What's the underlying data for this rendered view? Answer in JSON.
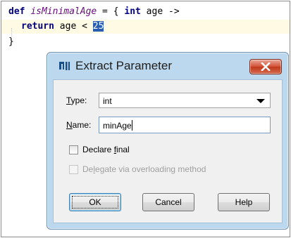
{
  "editor": {
    "line1": {
      "kw": "def",
      "ident": "isMinimalAge",
      "rest": " = { ",
      "type_kw": "int",
      "tail": " age ->"
    },
    "line2": {
      "kw": "return",
      "expr": " age < ",
      "selected": "25"
    },
    "line3": {
      "text": "}"
    }
  },
  "dialog": {
    "title": "Extract Parameter",
    "type": {
      "label_mnemonic": "T",
      "label_rest": "ype:",
      "value": "int"
    },
    "name": {
      "label_mnemonic": "N",
      "label_rest": "ame:",
      "value": "minAge"
    },
    "declare_final": {
      "label_pre": "Declare ",
      "label_mnemonic": "f",
      "label_post": "inal",
      "checked": false
    },
    "delegate": {
      "label_pre": "De",
      "label_mnemonic": "l",
      "label_post": "egate via overloading method",
      "checked": false,
      "enabled": false
    },
    "buttons": {
      "ok": "OK",
      "cancel": "Cancel",
      "help": "Help"
    }
  },
  "icons": {
    "app": "intellij-idea-icon",
    "close": "close-icon",
    "dropdown": "chevron-down-icon"
  },
  "colors": {
    "keyword": "#000080",
    "identifier": "#660e7a",
    "selection": "#2a5db0",
    "current_line": "#fffae3",
    "close_button": "#c0391b",
    "dialog_frame": "#bcd8ee"
  }
}
